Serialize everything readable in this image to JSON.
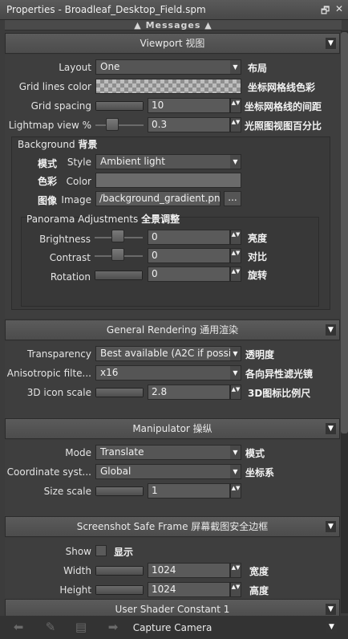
{
  "window": {
    "title": "Properties - Broadleaf_Desktop_Field.spm",
    "restore_icon": "restore-icon",
    "close_icon": "close-icon",
    "restore_glyph": "🗗",
    "close_glyph": "✕"
  },
  "messages": {
    "label": "▲ Messages ▲"
  },
  "viewport": {
    "header": "Viewport  视图",
    "layout": {
      "label": "Layout",
      "value": "One",
      "cn": "布局"
    },
    "grid_lines_color": {
      "label": "Grid lines color",
      "cn": "坐标网格线色彩"
    },
    "grid_spacing": {
      "label": "Grid spacing",
      "value": "10",
      "cn": "坐标网格线的间距"
    },
    "lightmap_view": {
      "label": "Lightmap view %",
      "value": "0.3",
      "cn": "光照图视图百分比"
    },
    "background": {
      "title": "Background",
      "title_cn": "背景",
      "style": {
        "cn": "模式",
        "label": "Style",
        "value": "Ambient light"
      },
      "color": {
        "cn": "色彩",
        "label": "Color"
      },
      "image": {
        "cn": "图像",
        "label": "Image",
        "value": "/background_gradient.png",
        "browse": "..."
      }
    },
    "panorama": {
      "title": "Panorama Adjustments",
      "title_cn": "全景调整",
      "brightness": {
        "label": "Brightness",
        "value": "0",
        "cn": "亮度"
      },
      "contrast": {
        "label": "Contrast",
        "value": "0",
        "cn": "对比"
      },
      "rotation": {
        "label": "Rotation",
        "value": "0",
        "cn": "旋转"
      }
    }
  },
  "general_rendering": {
    "header": "General Rendering  通用渲染",
    "transparency": {
      "label": "Transparency",
      "value": "Best available (A2C if possibl",
      "cn": "透明度"
    },
    "anisotropic": {
      "label": "Anisotropic filte...",
      "value": "x16",
      "cn": "各向异性滤光镜"
    },
    "icon_scale": {
      "label": "3D icon scale",
      "value": "2.8",
      "cn": "3D图标比例尺"
    }
  },
  "manipulator": {
    "header": "Manipulator  操纵",
    "mode": {
      "label": "Mode",
      "value": "Translate",
      "cn": "模式"
    },
    "coord": {
      "label": "Coordinate syst...",
      "value": "Global",
      "cn": "坐标系"
    },
    "size_scale": {
      "label": "Size scale",
      "value": "1"
    }
  },
  "safe_frame": {
    "header": "Screenshot Safe Frame  屏幕截图安全边框",
    "show": {
      "label": "Show",
      "cn": "显示",
      "checked": false
    },
    "width": {
      "label": "Width",
      "value": "1024",
      "cn": "宽度"
    },
    "height": {
      "label": "Height",
      "value": "1024",
      "cn": "高度"
    }
  },
  "user_shader": {
    "header": "User Shader Constant 1"
  },
  "capture_camera": {
    "header": "Capture Camera"
  },
  "icons": {
    "triangle": "▼",
    "spin": "▲▼",
    "dropdown_arrow": "▼",
    "back": "⬅",
    "pencil": "✎",
    "list": "▤",
    "forward": "➡"
  }
}
